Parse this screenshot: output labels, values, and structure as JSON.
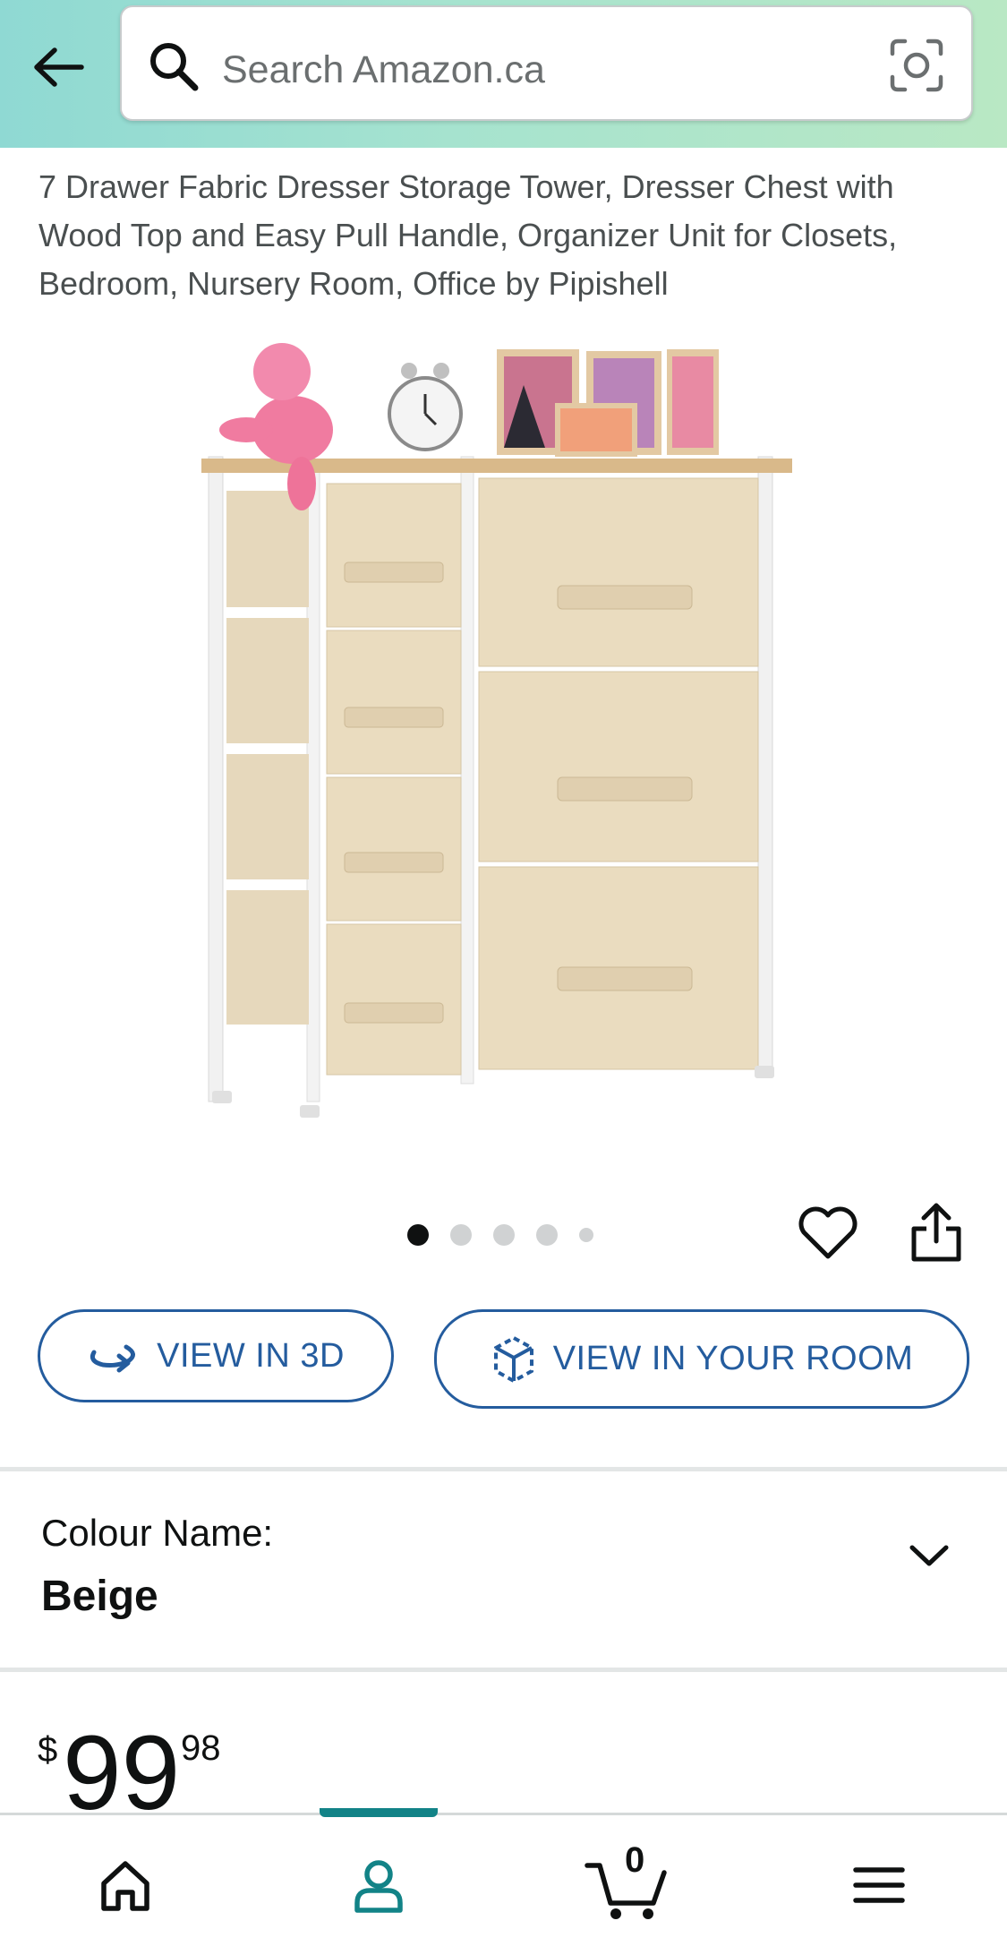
{
  "search": {
    "placeholder": "Search Amazon.ca"
  },
  "product": {
    "title": "7 Drawer Fabric Dresser Storage Tower, Dresser Chest with Wood Top and Easy Pull Handle, Organizer Unit for Closets, Bedroom, Nursery Room, Office by Pipishell"
  },
  "carousel": {
    "total_images": 5,
    "active_index": 0
  },
  "buttons": {
    "view_3d": "VIEW IN 3D",
    "view_room": "VIEW IN YOUR ROOM"
  },
  "colour": {
    "label": "Colour Name:",
    "value": "Beige"
  },
  "price": {
    "currency": "$",
    "whole": "99",
    "fraction": "98"
  },
  "nav": {
    "cart_count": "0"
  },
  "icons": [
    "back-arrow-icon",
    "search-icon",
    "camera-lens-icon",
    "heart-icon",
    "share-icon",
    "rotate-3d-icon",
    "ar-cube-icon",
    "chevron-down-icon",
    "home-icon",
    "user-icon",
    "cart-icon",
    "menu-icon"
  ],
  "colors": {
    "accent_blue": "#245c9e",
    "teal": "#128387",
    "header_gradient_start": "#8fd9d3",
    "header_gradient_end": "#b9e8c4"
  }
}
